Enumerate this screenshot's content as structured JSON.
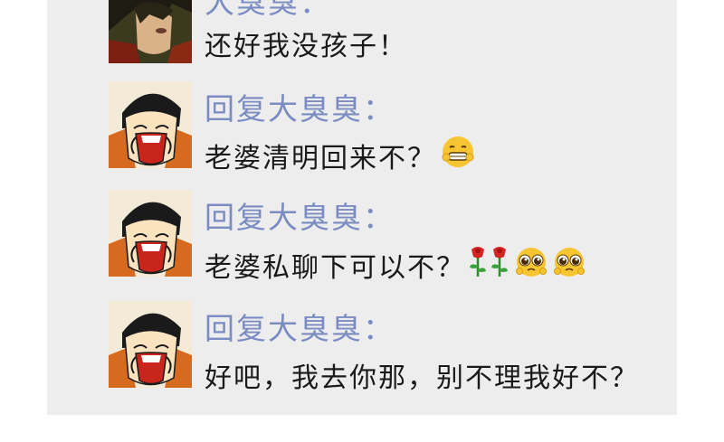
{
  "messages": [
    {
      "sender": "大臭臭：",
      "text": "还好我没孩子！",
      "emojis": [],
      "avatar_icon": "dark-hair-warrior-avatar"
    },
    {
      "sender": "回复大臭臭：",
      "text": "老婆清明回来不？",
      "emojis": [
        "grimacing-smile-emoji"
      ],
      "avatar_icon": "laughing-cartoon-man-avatar"
    },
    {
      "sender": "回复大臭臭：",
      "text": "老婆私聊下可以不？",
      "emojis": [
        "rose-emoji",
        "rose-emoji",
        "pleading-face-emoji",
        "pleading-face-emoji"
      ],
      "avatar_icon": "laughing-cartoon-man-avatar"
    },
    {
      "sender": "回复大臭臭：",
      "text": "好吧，我去你那，别不理我好不？",
      "emojis": [],
      "avatar_icon": "laughing-cartoon-man-avatar"
    }
  ],
  "colors": {
    "panel_bg": "#ededed",
    "sender_name": "#7a8cc2",
    "message_text": "#1a1a1a"
  }
}
